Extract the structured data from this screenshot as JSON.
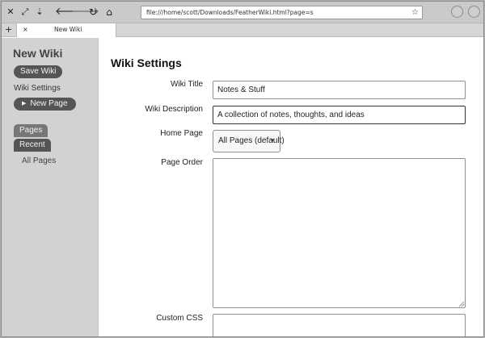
{
  "browser": {
    "url": "file:///home/scott/Downloads/FeatherWiki.html?page=s",
    "tab_title": "New Wiki",
    "new_tab_glyph": "+",
    "tab_close_glyph": "×",
    "icons": [
      "close-window-icon",
      "expand-icon",
      "download-icon",
      "back-icon",
      "forward-icon",
      "reload-icon",
      "home-icon",
      "bookmark-star-icon",
      "extension-icon",
      "account-icon"
    ]
  },
  "sidebar": {
    "wiki_name": "New Wiki",
    "save_label": "Save Wiki",
    "settings_label": "Wiki Settings",
    "new_page_label": "New Page",
    "tabs": [
      {
        "label": "Pages"
      },
      {
        "label": "Recent"
      }
    ],
    "pages_list": [
      {
        "label": "All Pages"
      }
    ]
  },
  "settings": {
    "title": "Wiki Settings",
    "wiki_title_label": "Wiki Title",
    "wiki_title_value": "Notes & Stuff",
    "wiki_description_label": "Wiki Description",
    "wiki_description_value": "A collection of notes, thoughts, and ideas",
    "home_page_label": "Home Page",
    "home_page_value": "All Pages (default)",
    "page_order_label": "Page Order",
    "page_order_value": "",
    "custom_css_label": "Custom CSS",
    "custom_css_value": ""
  }
}
